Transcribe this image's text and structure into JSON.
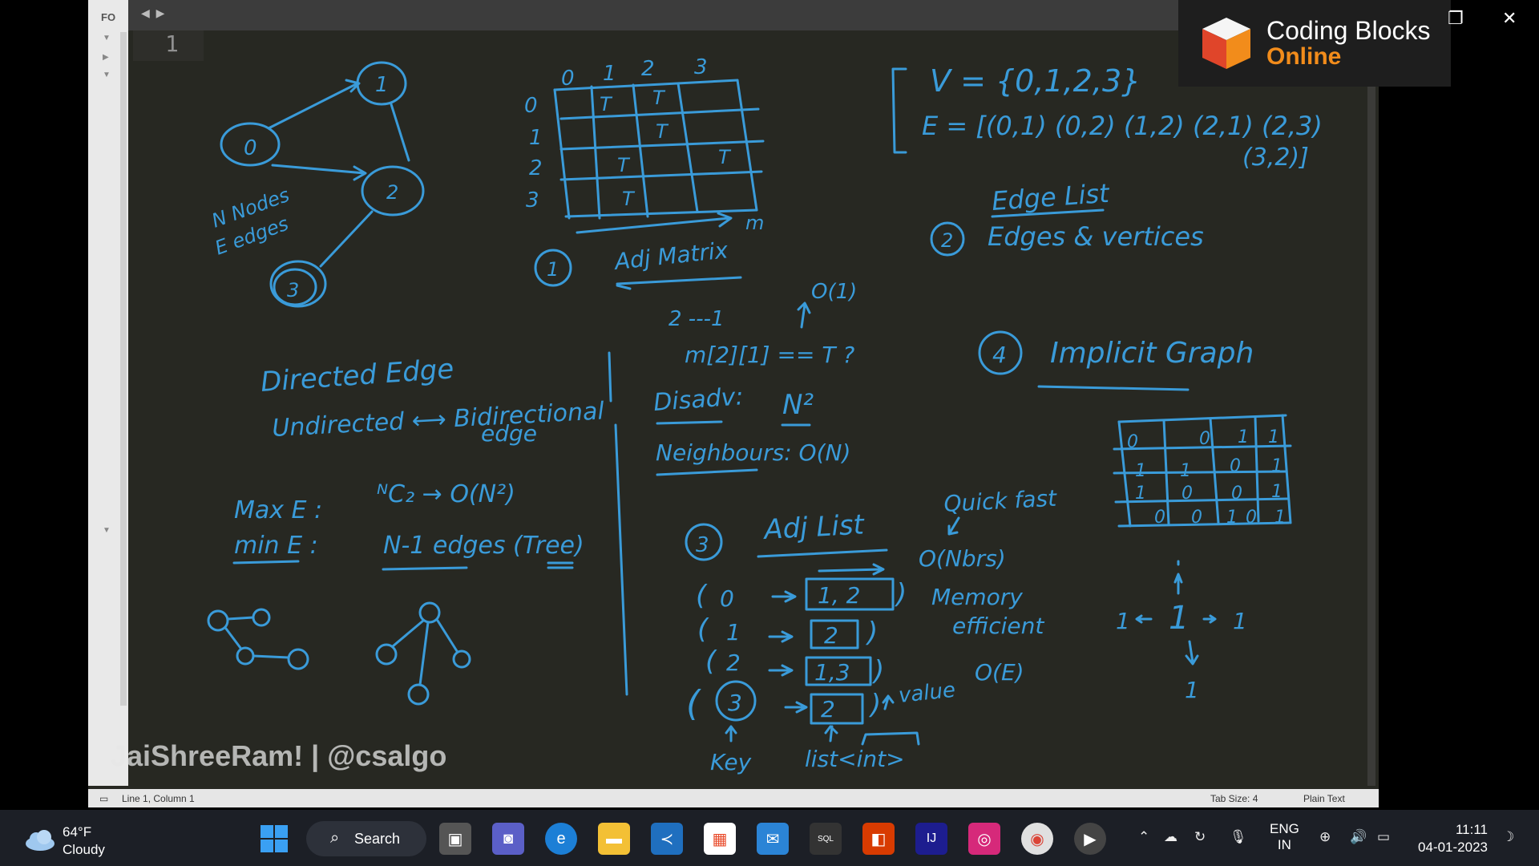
{
  "editor": {
    "panel_label": "FO",
    "line_number": "1",
    "status_left": "Line 1, Column 1",
    "tab_size": "Tab Size: 4",
    "syntax": "Plain Text"
  },
  "logo": {
    "title": "Coding Blocks",
    "subtitle": "Online"
  },
  "watermark": "JaiShreeRam! | @csalgo",
  "notes": {
    "n_nodes": "N Nodes",
    "e_edges": "E edges",
    "directed": "Directed Edge",
    "undirected": "Undirected ⟷ Bidirectional",
    "edge": "edge",
    "max_e": "Max E :",
    "max_e_val": "ᴺC₂ → O(N²)",
    "min_e": "min E :",
    "min_e_val": "N-1 edges (Tree)",
    "adj_matrix_num": "1",
    "adj_matrix": "Adj Matrix",
    "matrix_cols": [
      "0",
      "1",
      "2",
      "3"
    ],
    "matrix_rows": [
      "0",
      "1",
      "2",
      "3"
    ],
    "m_label": "m",
    "o1": "O(1)",
    "two_one": "2 ---1",
    "query": "m[2][1] == T ?",
    "disadv": "Disadv:",
    "n_squared": "N²",
    "neighbours": "Neighbours: O(N)",
    "vset": "V = {0,1,2,3}",
    "eset": "E = [(0,1) (0,2) (1,2) (2,1) (2,3)",
    "eset2": "(3,2)]",
    "edge_list": "Edge List",
    "edge_list_num": "2",
    "edges_vertices": "Edges & vertices",
    "implicit_num": "4",
    "implicit": "Implicit Graph",
    "adj_list_num": "3",
    "adj_list": "Adj List",
    "quick_fast": "Quick fast",
    "o_nbrs": "O(Nbrs)",
    "memory": "Memory",
    "efficient": "efficient",
    "o_e": "O(E)",
    "value": "value",
    "key": "Key",
    "list_int": "list<int>",
    "rows": [
      {
        "key": "0",
        "val": "1, 2"
      },
      {
        "key": "1",
        "val": "2"
      },
      {
        "key": "2",
        "val": "1,3"
      },
      {
        "key": "3",
        "val": "2"
      }
    ],
    "grid": [
      [
        "0",
        "",
        "0",
        "1",
        "1"
      ],
      [
        "1",
        "1",
        "",
        "0",
        "1"
      ],
      [
        "1",
        "0",
        "",
        "0",
        "1"
      ],
      [
        "",
        "0",
        "0",
        "0",
        "1"
      ]
    ],
    "one": "1"
  },
  "taskbar": {
    "temp": "64°F",
    "condition": "Cloudy",
    "search": "Search",
    "lang1": "ENG",
    "lang2": "IN",
    "time": "11:11",
    "date": "04-01-2023"
  }
}
